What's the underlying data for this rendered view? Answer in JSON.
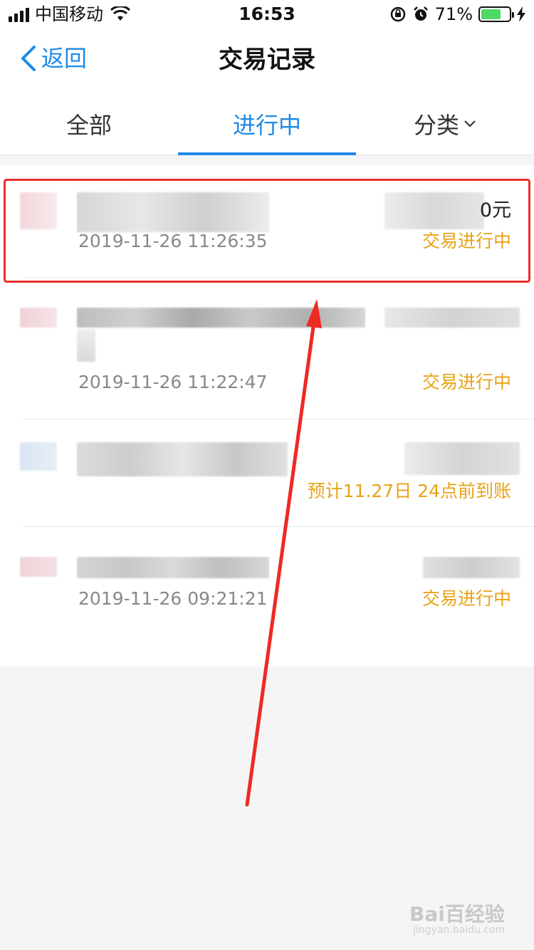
{
  "status_bar": {
    "carrier": "中国移动",
    "time": "16:53",
    "battery": "71%",
    "battery_level": 0.71
  },
  "nav": {
    "back_label": "返回",
    "title": "交易记录"
  },
  "tabs": [
    {
      "label": "全部"
    },
    {
      "label": "进行中"
    },
    {
      "label": "分类"
    }
  ],
  "transactions": [
    {
      "amount_suffix": "0元",
      "date": "2019-11-26 11:26:35",
      "status": "交易进行中"
    },
    {
      "date": "2019-11-26 11:22:47",
      "status": "交易进行中"
    },
    {
      "status": "预计11.27日 24点前到账"
    },
    {
      "date": "2019-11-26 09:21:21",
      "status": "交易进行中"
    }
  ],
  "watermark": {
    "brand": "Bai百经验",
    "url": "jingyan.baidu.com"
  },
  "colors": {
    "accent": "#1d8ae6",
    "status": "#e8a317",
    "highlight": "#e8302c"
  }
}
